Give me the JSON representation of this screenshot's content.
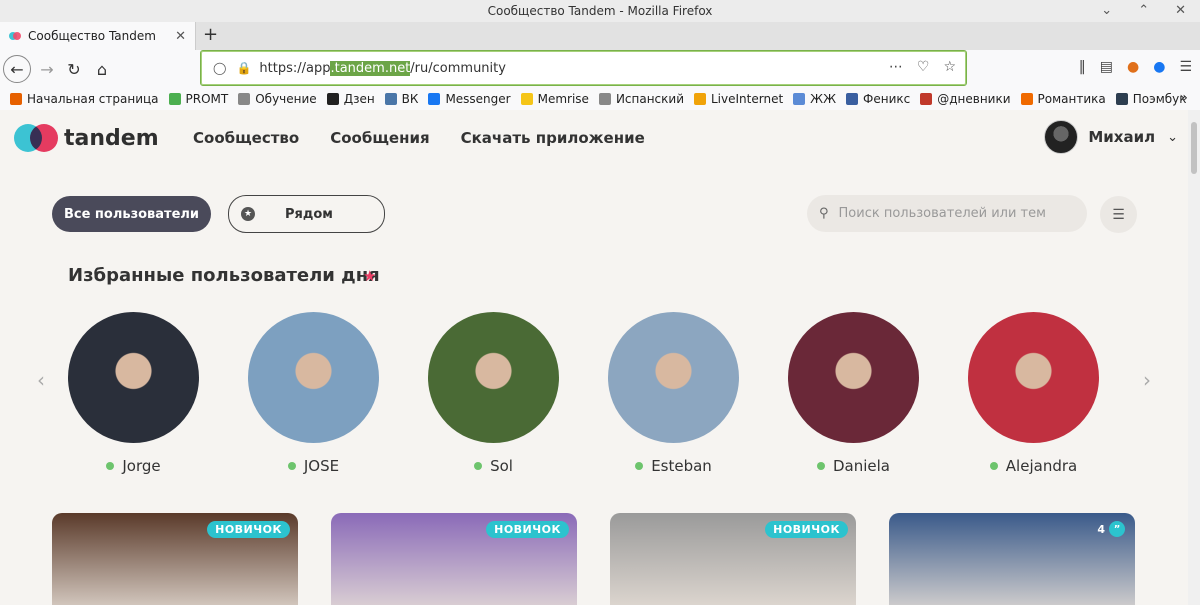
{
  "window": {
    "title": "Сообщество Tandem - Mozilla Firefox"
  },
  "tab": {
    "title": "Сообщество Tandem"
  },
  "url": {
    "prefix": "https://app",
    "highlight": ".tandem.net",
    "suffix": "/ru/community"
  },
  "bookmarks": [
    {
      "label": "Начальная страница",
      "color": "#e66000"
    },
    {
      "label": "PROMT",
      "color": "#4caf50"
    },
    {
      "label": "Обучение",
      "color": "#888888"
    },
    {
      "label": "Дзен",
      "color": "#222222"
    },
    {
      "label": "ВК",
      "color": "#4a76a8"
    },
    {
      "label": "Messenger",
      "color": "#1877f2"
    },
    {
      "label": "Memrise",
      "color": "#f5c518"
    },
    {
      "label": "Испанский",
      "color": "#888888"
    },
    {
      "label": "LiveInternet",
      "color": "#f0a30a"
    },
    {
      "label": "ЖЖ",
      "color": "#5b8bd6"
    },
    {
      "label": "Феникс",
      "color": "#3a5fa0"
    },
    {
      "label": "@дневники",
      "color": "#c0392b"
    },
    {
      "label": "Романтика",
      "color": "#f06a00"
    },
    {
      "label": "Поэмбук",
      "color": "#2d3e50"
    }
  ],
  "app": {
    "logo": "tandem",
    "nav": [
      "Сообщество",
      "Сообщения",
      "Скачать приложение"
    ],
    "user_name": "Михаил",
    "filters": {
      "all": "Все пользователи",
      "near": "Рядом"
    },
    "search_placeholder": "Поиск пользователей или тем",
    "section_title": "Избранные пользователи дня",
    "featured": [
      {
        "name": "Jorge",
        "bg": "#2a2f3a"
      },
      {
        "name": "JOSE",
        "bg": "#7da0c0"
      },
      {
        "name": "Sol",
        "bg": "#4a6a35"
      },
      {
        "name": "Esteban",
        "bg": "#8ca6c0"
      },
      {
        "name": "Daniela",
        "bg": "#6a2838"
      },
      {
        "name": "Alejandra",
        "bg": "#c03040"
      }
    ],
    "cards": [
      {
        "badge": "НОВИЧОК",
        "bg": "#5a3a2a"
      },
      {
        "badge": "НОВИЧОК",
        "bg": "#8a6ab8"
      },
      {
        "badge": "НОВИЧОК",
        "bg": "#9a9a9a"
      },
      {
        "badge": "4",
        "bg": "#3a5a8a"
      }
    ]
  }
}
